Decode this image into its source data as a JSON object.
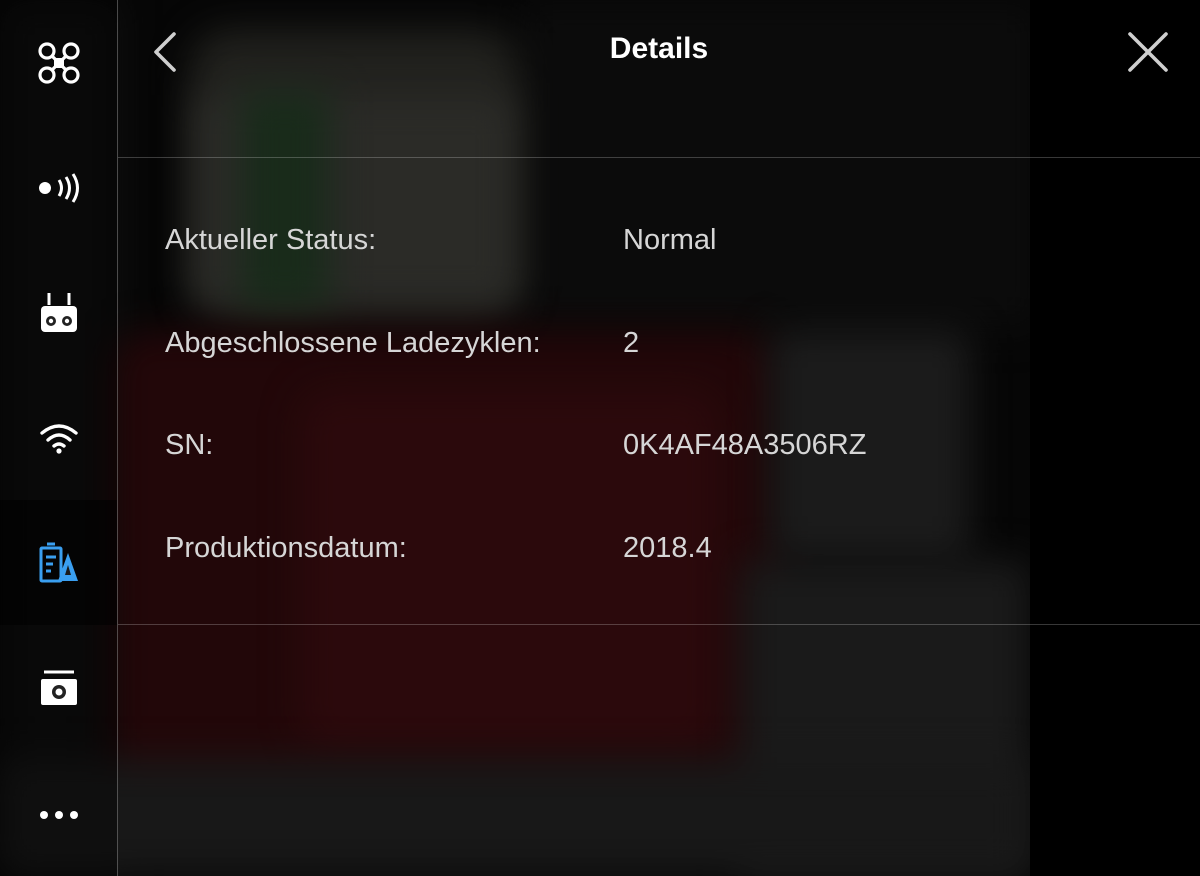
{
  "header": {
    "title": "Details",
    "back_icon": "chevron-left-icon",
    "close_icon": "close-icon"
  },
  "sidebar": {
    "items": [
      {
        "name": "aircraft",
        "icon": "drone-icon",
        "active": false
      },
      {
        "name": "sensors",
        "icon": "signal-icon",
        "active": false
      },
      {
        "name": "remote-controller",
        "icon": "remote-controller-icon",
        "active": false
      },
      {
        "name": "transmission",
        "icon": "wifi-icon",
        "active": false
      },
      {
        "name": "battery",
        "icon": "battery-icon",
        "active": true
      },
      {
        "name": "camera",
        "icon": "camera-icon",
        "active": false
      },
      {
        "name": "more",
        "icon": "more-icon",
        "active": false
      }
    ],
    "accent_color": "#3a9ff0"
  },
  "details": {
    "rows": [
      {
        "label": "Aktueller Status:",
        "value": "Normal"
      },
      {
        "label": "Abgeschlossene Ladezyklen:",
        "value": "2"
      },
      {
        "label": "SN:",
        "value": "0K4AF48A3506RZ"
      },
      {
        "label": "Produktionsdatum:",
        "value": "2018.4"
      }
    ]
  }
}
